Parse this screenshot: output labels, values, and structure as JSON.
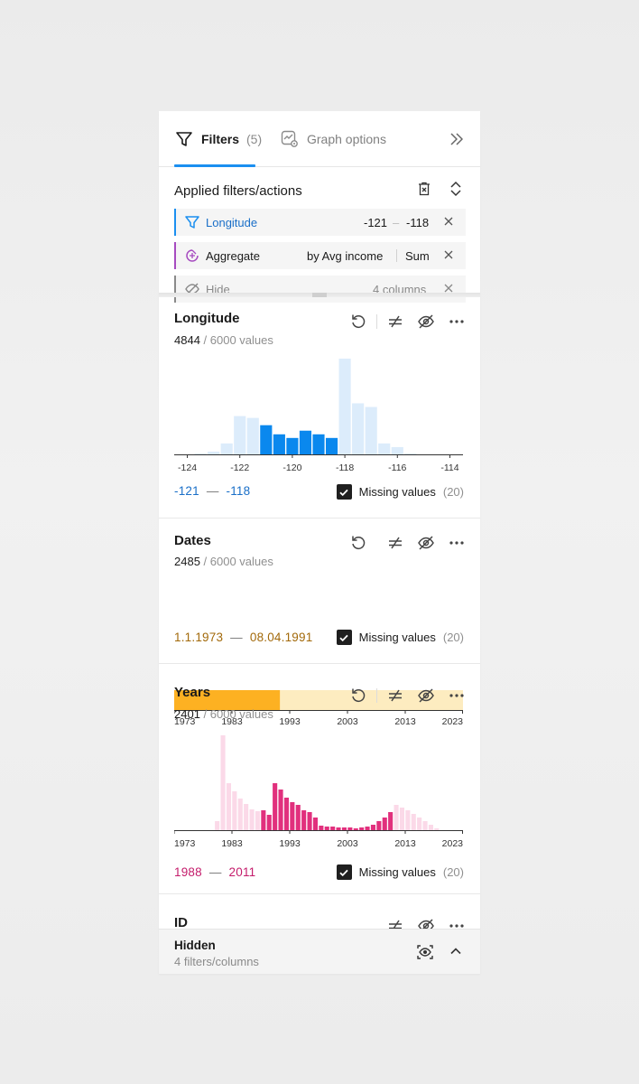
{
  "tabs": {
    "filters_label": "Filters",
    "filters_count": "(5)",
    "graph_label": "Graph options"
  },
  "applied": {
    "title": "Applied filters/actions",
    "chips": [
      {
        "name": "Longitude",
        "value_from": "-121",
        "dash": "–",
        "value_to": "-118",
        "color": "#1b8ff0"
      },
      {
        "name": "Aggregate",
        "by": "by Avg income",
        "func": "Sum",
        "color": "#a64bc0"
      },
      {
        "name": "Hide",
        "value": "4 columns",
        "color": "#8a8a8a"
      }
    ]
  },
  "filters": [
    {
      "title": "Longitude",
      "matched": "4844",
      "total": "/ 6000  values",
      "range_from": "-121",
      "range_to": "-118",
      "range_dash": "—",
      "range_color": "#1a6fc8",
      "missing_label": "Missing values",
      "missing_count": "(20)"
    },
    {
      "title": "Dates",
      "matched": "2485",
      "total": "/ 6000  values",
      "range_from": "1.1.1973",
      "range_to": "08.04.1991",
      "range_dash": "—",
      "range_color": "#a2690a",
      "missing_label": "Missing values",
      "missing_count": "(20)"
    },
    {
      "title": "Years",
      "matched": "2401",
      "total": "/ 6000  values",
      "range_from": "1988",
      "range_to": "2011",
      "range_dash": "—",
      "range_color": "#c41c6b",
      "missing_label": "Missing values",
      "missing_count": "(20)"
    },
    {
      "title": "ID"
    }
  ],
  "footer": {
    "title": "Hidden",
    "subtitle": "4 filters/columns"
  },
  "colors": {
    "blue": "#0a88ee",
    "blue_light": "#dcecfb",
    "orange": "#fdb122",
    "orange_light": "#fdecc0",
    "pink": "#e1307d",
    "pink_light": "#fbd9e8"
  },
  "chart_data": [
    {
      "type": "bar",
      "title": "Longitude",
      "x_ticks": [
        "-124",
        "-122",
        "-120",
        "-118",
        "-116",
        "-114"
      ],
      "xlim": [
        -124.5,
        -113.5
      ],
      "bin_width": 0.5,
      "x": [
        -123.5,
        -123,
        -122.5,
        -122,
        -121.5,
        -121,
        -120.5,
        -120,
        -119.5,
        -119,
        -118.5,
        -118,
        -117.5,
        -117,
        -116.5,
        -116,
        -115.5
      ],
      "values": [
        1,
        3,
        12,
        42,
        40,
        32,
        22,
        18,
        26,
        22,
        18,
        105,
        56,
        52,
        12,
        8,
        1
      ],
      "selected_range": [
        -121,
        -118
      ]
    },
    {
      "type": "bar",
      "title": "Dates",
      "x_ticks": [
        "1973",
        "1983",
        "1993",
        "2003",
        "2013",
        "2023"
      ],
      "xlim": [
        1973,
        2023
      ],
      "selected_range": [
        1973,
        1991.3
      ]
    },
    {
      "type": "bar",
      "title": "Years",
      "x_ticks": [
        "1973",
        "1983",
        "1993",
        "2003",
        "2013",
        "2023"
      ],
      "xlim": [
        1973,
        2023
      ],
      "x": [
        1980,
        1981,
        1982,
        1983,
        1984,
        1985,
        1986,
        1987,
        1988,
        1989,
        1990,
        1991,
        1992,
        1993,
        1994,
        1995,
        1996,
        1997,
        1998,
        1999,
        2000,
        2001,
        2002,
        2003,
        2004,
        2005,
        2006,
        2007,
        2008,
        2009,
        2010,
        2011,
        2012,
        2013,
        2014,
        2015,
        2016,
        2017,
        2018
      ],
      "values": [
        10,
        105,
        52,
        43,
        35,
        29,
        23,
        21,
        22,
        17,
        52,
        45,
        36,
        31,
        28,
        22,
        20,
        14,
        5,
        4,
        4,
        3,
        3,
        3,
        2,
        3,
        4,
        6,
        10,
        14,
        20,
        28,
        25,
        22,
        18,
        14,
        10,
        6,
        2
      ],
      "selected_range": [
        1988,
        2011
      ]
    }
  ]
}
